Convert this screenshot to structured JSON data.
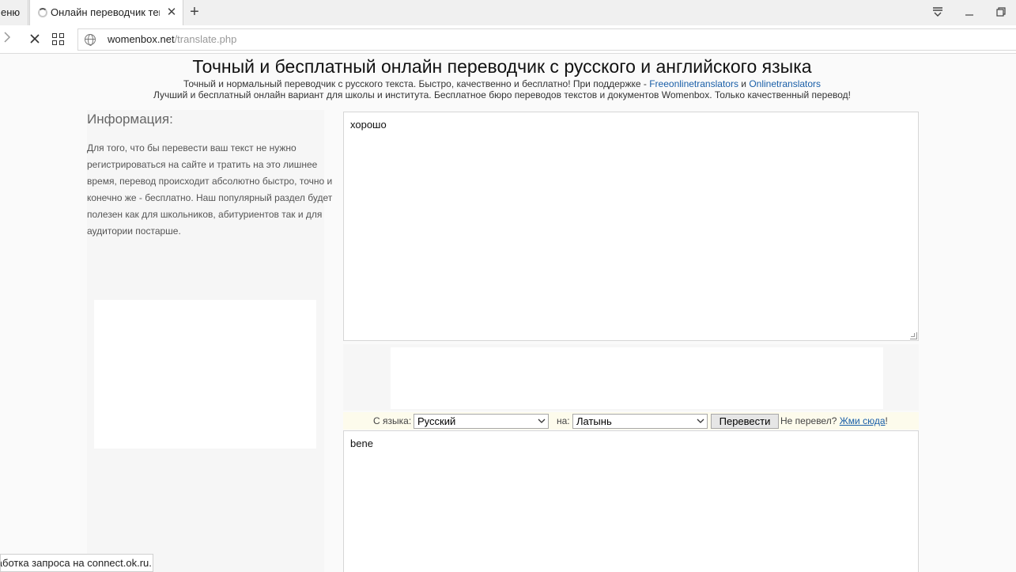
{
  "browser": {
    "menu_label": "Меню",
    "tab_title": "Онлайн переводчик текста",
    "tab_close": "✕",
    "new_tab": "+",
    "url_host": "womenbox.net",
    "url_path": "/translate.php",
    "status_text": "Обработка запроса на connect.ok.ru..."
  },
  "header": {
    "title": "Точный и бесплатный онлайн переводчик с русского и английского языка",
    "sub1_prefix": "Точный и нормальный переводчик с русского текста. Быстро, качественно и бесплатно! При поддержке - ",
    "sub1_link1": "Freeonlinetranslators",
    "sub1_mid": " и ",
    "sub1_link2": "Onlinetranslators",
    "sub2": "Лучший и бесплатный онлайн вариант для школы и института. Бесплатное бюро переводов текстов и документов Womenbox. Только качественный перевод!"
  },
  "sidebar": {
    "title": "Информация:",
    "text": "Для того, что бы перевести ваш текст не нужно регистрироваться на сайте и тратить на это лишнее время, перевод происходит абсолютно быстро, точно и конечно же - бесплатно. Наш популярный раздел будет полезен как для школьников, абитуриентов так и для аудитории постарше."
  },
  "translator": {
    "source_text": "хорошо",
    "from_label": "С языка:",
    "from_value": "Русский",
    "to_label": "на:",
    "to_value": "Латынь",
    "translate_button": "Перевести",
    "not_translated": "Не перевел? ",
    "click_here": "Жми сюда",
    "exclam": "!",
    "result_text": "bene"
  }
}
